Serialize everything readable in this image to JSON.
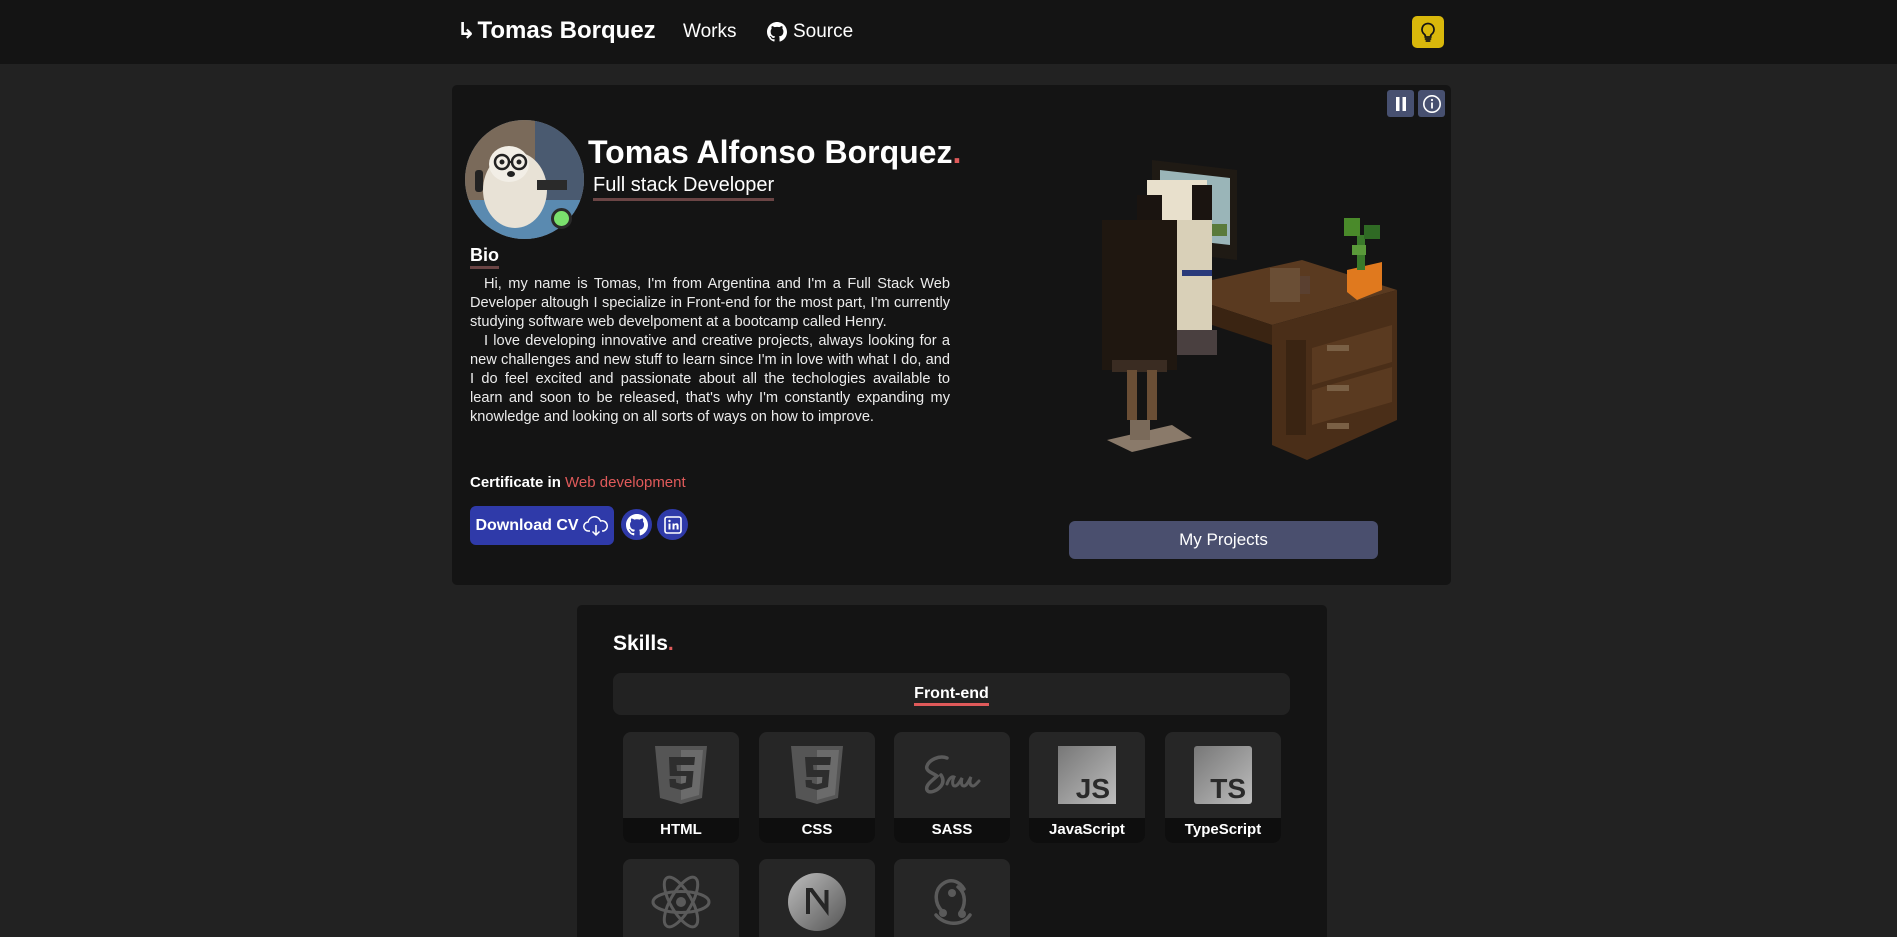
{
  "nav": {
    "brand_arrow": "↳",
    "brand": "Tomas Borquez",
    "links": [
      {
        "label": "Works"
      },
      {
        "label": "Source",
        "icon": "github-icon"
      }
    ],
    "theme_toggle_icon": "lightbulb-icon",
    "colors": {
      "bg": "#141414",
      "theme_toggle": "#d9b80b"
    }
  },
  "hero": {
    "name": "Tomas Alfonso Borquez",
    "name_dot": ".",
    "role": "Full stack Developer",
    "bio_title": "Bio",
    "bio_paragraphs": [
      "Hi, my name is Tomas, I'm from Argentina and I'm a Full Stack Web Developer altough I specialize in Front-end for the most part, I'm currently studying software web develpoment at a bootcamp called Henry.",
      "I love developing innovative and creative projects, always looking for a new challenges and new stuff to learn since I'm in love with what I do, and I do feel excited and passionate about all the techologies available to learn and soon to be released, that's why I'm constantly expanding my knowledge and looking on all sorts of ways on how to improve."
    ],
    "certificate_prefix": "Certificate in",
    "certificate_highlight": "Web development",
    "download_cv_label": "Download CV",
    "download_cv_icon": "cloud-download-icon",
    "social": [
      {
        "icon": "github-icon"
      },
      {
        "icon": "linkedin-icon"
      }
    ],
    "scene_controls": [
      {
        "icon": "pause-icon"
      },
      {
        "icon": "info-icon"
      }
    ],
    "my_projects_label": "My Projects",
    "status": "online",
    "colors": {
      "accent": "#e05a5a",
      "button": "#2f3aa9",
      "projects_button": "#4a4f6e",
      "status": "#7ae06d"
    }
  },
  "skills": {
    "title": "Skills",
    "title_dot": ".",
    "active_tab": "Front-end",
    "items": [
      {
        "label": "HTML",
        "icon": "html5-icon"
      },
      {
        "label": "CSS",
        "icon": "css3-icon"
      },
      {
        "label": "SASS",
        "icon": "sass-icon"
      },
      {
        "label": "JavaScript",
        "icon": "javascript-icon"
      },
      {
        "label": "TypeScript",
        "icon": "typescript-icon"
      },
      {
        "label": "",
        "icon": "react-icon"
      },
      {
        "label": "",
        "icon": "nextjs-icon"
      },
      {
        "label": "",
        "icon": "redux-icon"
      }
    ]
  }
}
